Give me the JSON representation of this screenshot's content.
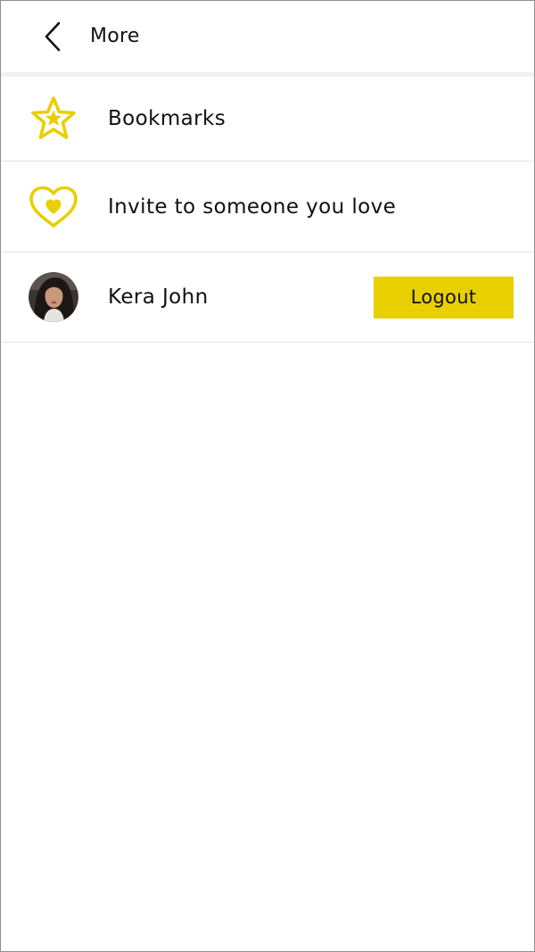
{
  "header": {
    "title": "More",
    "back_icon": "chevron-left-icon"
  },
  "menu": {
    "items": [
      {
        "label": "Bookmarks",
        "icon": "star-icon"
      },
      {
        "label": "Invite to someone you love",
        "icon": "heart-icon"
      }
    ]
  },
  "account": {
    "user_name": "Kera John",
    "logout_label": "Logout"
  },
  "colors": {
    "accent": "#e8cf00",
    "text": "#111111",
    "divider": "#e3e3e3"
  }
}
